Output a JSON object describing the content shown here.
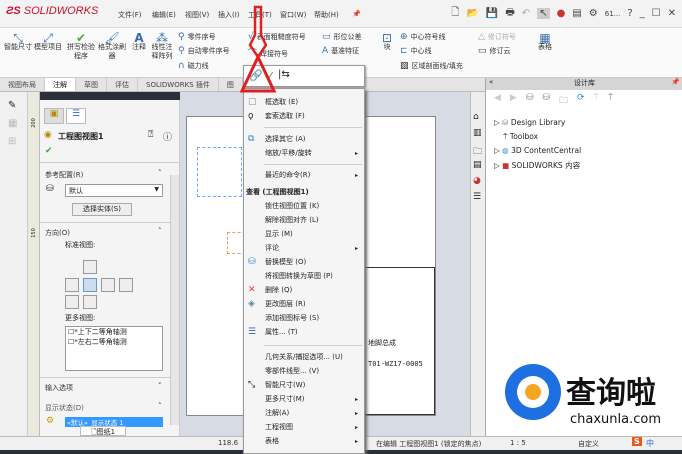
{
  "app": {
    "logo": "SOLIDWORKS",
    "menus": [
      "文件(F)",
      "编辑(E)",
      "视图(V)",
      "插入(I)",
      "工具(T)",
      "窗口(W)",
      "帮助(H)"
    ],
    "search": "61..."
  },
  "ribbon": {
    "big": [
      "智能尺寸",
      "模型项目",
      "拼写检验程序",
      "格式涂刷器",
      "注释",
      "线性注释阵列"
    ],
    "col1": [
      "零件序号",
      "自动零件序号",
      "磁力线"
    ],
    "col2": [
      "表面粗糙度符号",
      "焊接符号"
    ],
    "col3": [
      "形位公差",
      "基准特征"
    ],
    "block": "块",
    "col4": [
      "中心符号线",
      "中心线",
      "区域剖面线/填充"
    ],
    "col5": [
      "修订符号",
      "修订云"
    ],
    "table": "表格"
  },
  "tabs": [
    "视图布局",
    "注解",
    "草图",
    "评估",
    "SOLIDWORKS 插件",
    "图"
  ],
  "active_tab": "注解",
  "panel": {
    "title": "工程图视图1",
    "ref_config_label": "参考配置(R)",
    "ref_config_value": "默认",
    "select_body": "选择实体(S)",
    "orientation": "方向(O)",
    "standard_views": "标准视图:",
    "more_views": "更多视图:",
    "more_views_items": [
      "*上下二等角轴测",
      "*左右二等角轴测"
    ],
    "import_options": "输入选项",
    "display_state": "显示状态(D)",
    "display_state_value": "«默认»_显示状态 1",
    "bottom_tab": "图纸1"
  },
  "ruler": [
    "200",
    "150"
  ],
  "context_menu": {
    "items1": [
      {
        "label": "框选取 (E)",
        "icon": "box-select-icon"
      },
      {
        "label": "套索选取 (F)",
        "icon": "lasso-icon"
      }
    ],
    "items2": [
      {
        "label": "选择其它 (A)",
        "icon": "select-other-icon"
      },
      {
        "label": "缩放/平移/旋转",
        "sub": true
      }
    ],
    "items3": [
      {
        "label": "最近的命令(R)",
        "sub": true
      }
    ],
    "header": "查看 (工程图视图1)",
    "items4": [
      {
        "label": "锁住视图位置 (K)"
      },
      {
        "label": "解除视图对齐 (L)"
      },
      {
        "label": "显示 (M)"
      },
      {
        "label": "评论",
        "sub": true
      },
      {
        "label": "替换模型 (O)",
        "icon": "replace-model-icon"
      },
      {
        "label": "将视图转换为草图 (P)"
      },
      {
        "label": "删除 (Q)",
        "icon": "delete-icon"
      },
      {
        "label": "更改图层 (R)",
        "icon": "layer-icon"
      },
      {
        "label": "添加视图标号 (S)"
      },
      {
        "label": "属性... (T)",
        "icon": "properties-icon"
      }
    ],
    "items5": [
      {
        "label": "几何关系/捕捉选项... (U)"
      },
      {
        "label": "零部件线型... (V)"
      },
      {
        "label": "智能尺寸(W)",
        "icon": "smart-dimension-icon"
      },
      {
        "label": "更多尺寸(M)",
        "sub": true
      },
      {
        "label": "注解(A)",
        "sub": true
      },
      {
        "label": "工程视图",
        "sub": true
      },
      {
        "label": "表格",
        "sub": true
      }
    ]
  },
  "title_block": {
    "name": "地脚总成",
    "code": "T01-WZ17-0005"
  },
  "design_library": {
    "title": "设计库",
    "items": [
      "Design Library",
      "Toolbox",
      "3D ContentCentral",
      "SOLIDWORKS 内容"
    ]
  },
  "status": {
    "coord": "118.6",
    "editing": "在编辑 工程图视图1 (锁定的焦点)",
    "scale": "1 : 5",
    "custom": "自定义",
    "ime": "中"
  },
  "watermark": {
    "text": "查询啦",
    "url": "chaxunla.com"
  },
  "colors": {
    "accent": "#c8102e",
    "annotation_arrow": "#e02020",
    "selection": "#3399ff"
  }
}
